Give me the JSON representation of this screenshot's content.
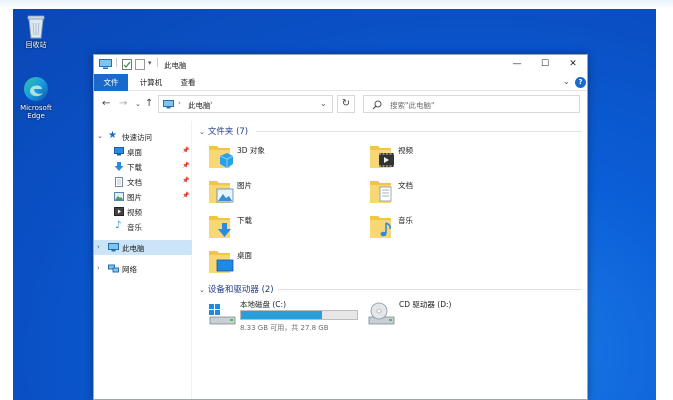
{
  "desktop": {
    "icons": [
      {
        "label": "回收站",
        "icon": "recycle-bin-icon"
      },
      {
        "label": "Microsoft Edge",
        "icon": "edge-icon"
      }
    ]
  },
  "window": {
    "title": "此电脑",
    "ribbon_tabs": [
      "文件",
      "计算机",
      "查看"
    ],
    "address": {
      "location": "此电脑"
    },
    "search": {
      "placeholder": "搜索\"此电脑\""
    }
  },
  "sidebar": {
    "quick_access": "快速访问",
    "items": [
      {
        "label": "桌面",
        "icon": "desktop-icon",
        "pinned": true
      },
      {
        "label": "下载",
        "icon": "download-icon",
        "pinned": true
      },
      {
        "label": "文档",
        "icon": "document-icon",
        "pinned": true
      },
      {
        "label": "图片",
        "icon": "picture-icon",
        "pinned": true
      },
      {
        "label": "视频",
        "icon": "video-icon",
        "pinned": false
      },
      {
        "label": "音乐",
        "icon": "music-icon",
        "pinned": false
      }
    ],
    "this_pc": "此电脑",
    "network": "网络"
  },
  "content": {
    "folders_header": "文件夹 (7)",
    "folders": [
      {
        "label": "3D 对象",
        "icon": "3d-objects-folder-icon"
      },
      {
        "label": "视频",
        "icon": "video-folder-icon"
      },
      {
        "label": "图片",
        "icon": "pictures-folder-icon"
      },
      {
        "label": "文档",
        "icon": "documents-folder-icon"
      },
      {
        "label": "下载",
        "icon": "downloads-folder-icon"
      },
      {
        "label": "音乐",
        "icon": "music-folder-icon"
      },
      {
        "label": "桌面",
        "icon": "desktop-folder-icon"
      }
    ],
    "devices_header": "设备和驱动器 (2)",
    "drives": [
      {
        "label": "本地磁盘 (C:)",
        "free_text": "8.33 GB 可用，共 27.8 GB",
        "used_fraction": 0.7
      },
      {
        "label": "CD 驱动器 (D:)"
      }
    ]
  },
  "colors": {
    "accent": "#1b6ac9",
    "selection": "#cce4f7",
    "drive_bar": "#26a0da",
    "folder": "#f3c640"
  }
}
